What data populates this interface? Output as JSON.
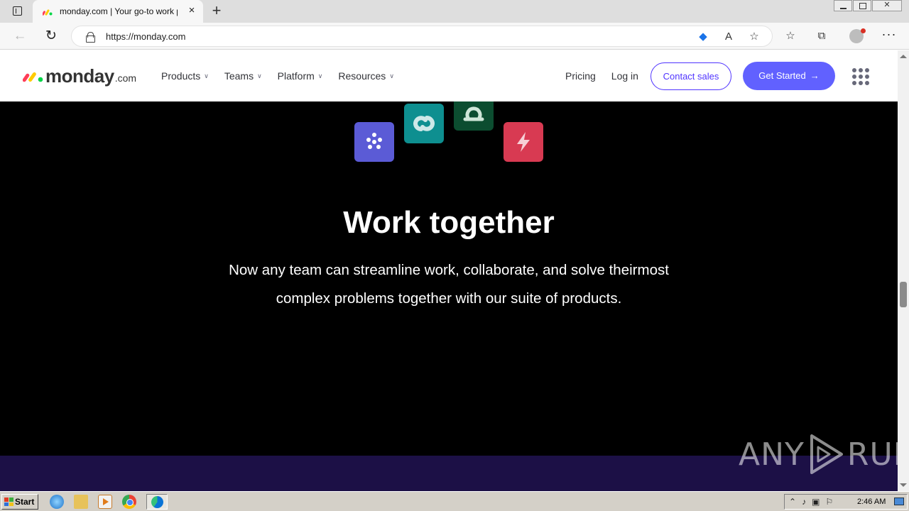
{
  "browser": {
    "tab_title": "monday.com | Your go-to work platform",
    "new_tab_label": "+",
    "tab_close_label": "×",
    "url": "https://monday.com",
    "icons": [
      "tab-actions-icon",
      "favicon-icon",
      "back-icon",
      "reload-icon",
      "lock-icon",
      "shopping-tag-icon",
      "read-aloud-icon",
      "add-favorite-icon",
      "favorites-icon",
      "collections-icon",
      "profile-icon",
      "more-icon",
      "minimize-icon",
      "maximize-icon",
      "close-icon"
    ]
  },
  "site": {
    "logo_word": "monday",
    "logo_suffix": ".com",
    "nav": [
      {
        "label": "Products"
      },
      {
        "label": "Teams"
      },
      {
        "label": "Platform"
      },
      {
        "label": "Resources"
      }
    ],
    "pricing_label": "Pricing",
    "login_label": "Log in",
    "contact_label": "Contact sales",
    "get_started_label": "Get Started",
    "accent": "#6161ff",
    "outline_color": "#5034ff"
  },
  "hero": {
    "title": "Work together",
    "text": "Now any team can streamline work, collaborate, and solve theirmost complex problems together with our suite of products.",
    "tiles": [
      {
        "name": "work-management-icon",
        "color": "#5b5bd6"
      },
      {
        "name": "crm-icon",
        "color": "#0e8f90"
      },
      {
        "name": "dev-icon",
        "color": "#0c4d30"
      },
      {
        "name": "automation-bolt-icon",
        "color": "#d83a52"
      }
    ],
    "background": "#000000",
    "band_color": "#1c1046"
  },
  "watermark": {
    "left": "ANY",
    "right": "RUN"
  },
  "taskbar": {
    "start_label": "Start",
    "clock": "2:46 AM",
    "apps": [
      "internet-explorer-icon",
      "folder-icon",
      "media-player-icon",
      "chrome-icon",
      "edge-icon"
    ]
  }
}
